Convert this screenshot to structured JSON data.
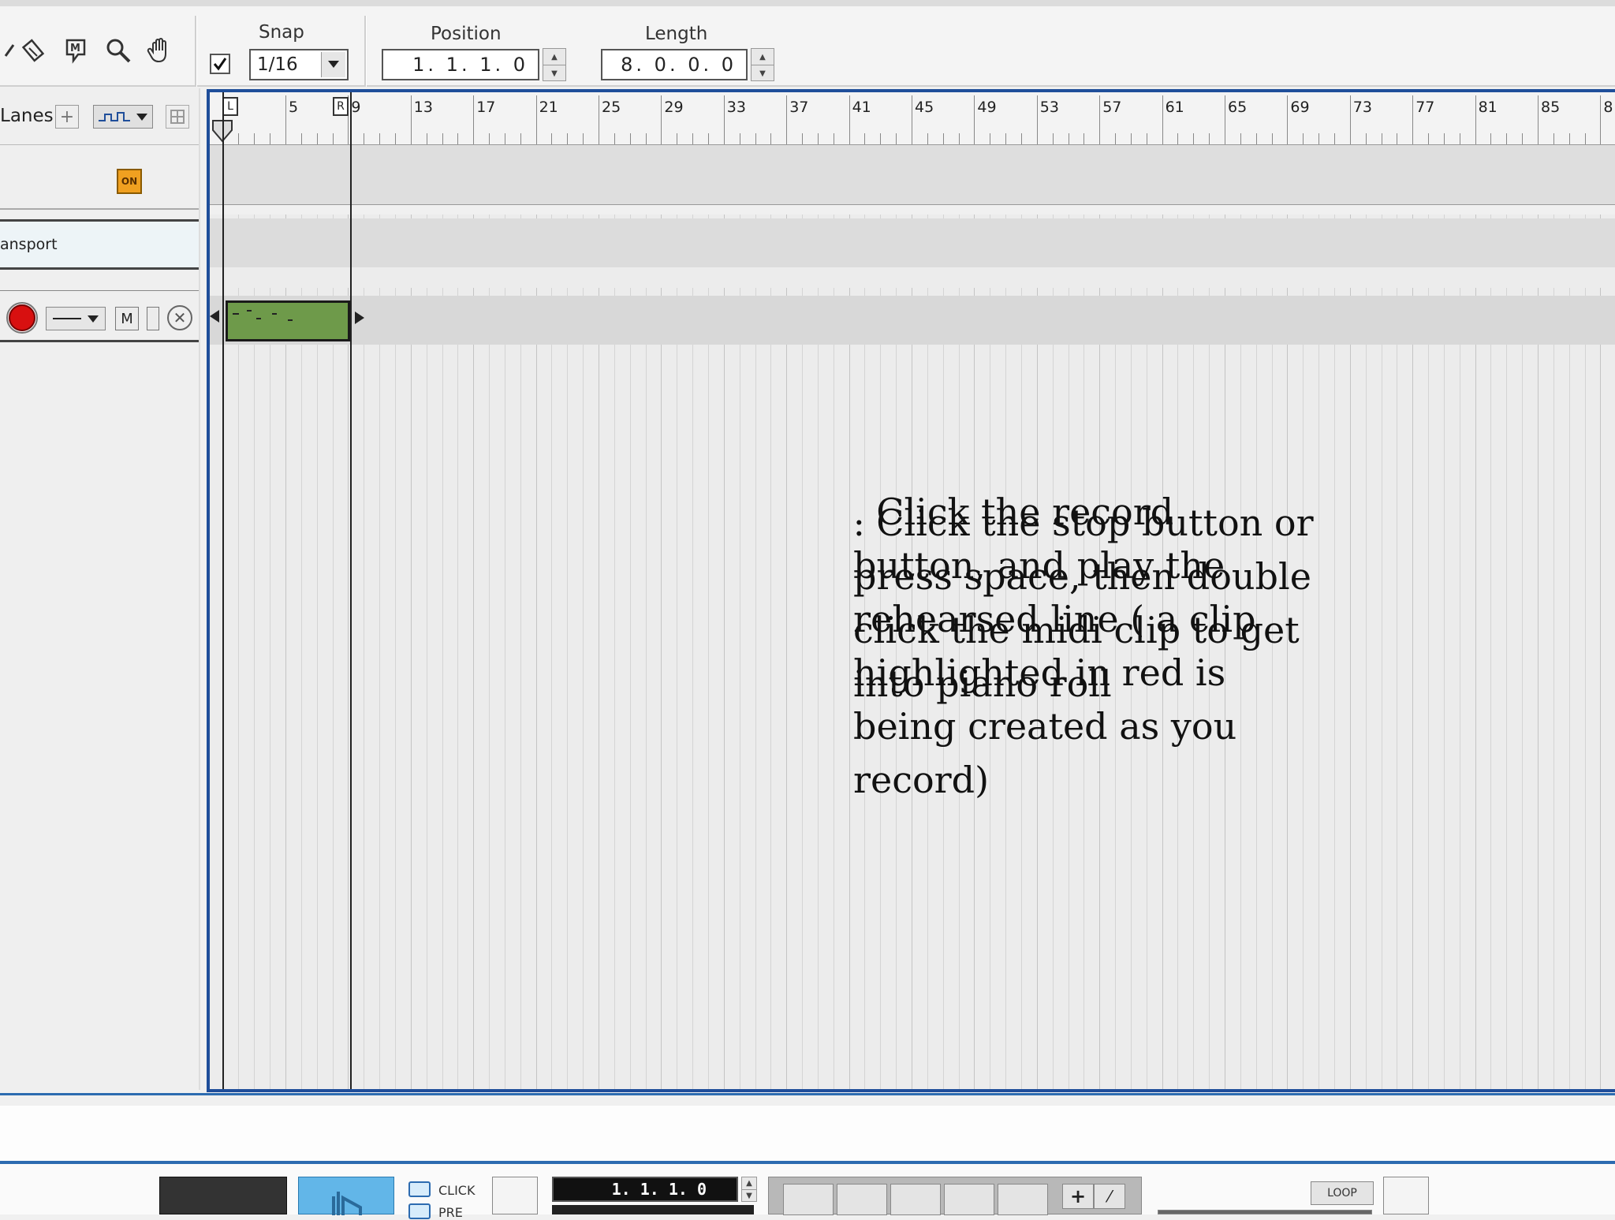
{
  "toolbar": {
    "tools": [
      "pencil-icon",
      "eraser-icon",
      "mute-tool-icon",
      "magnify-icon",
      "hand-icon"
    ],
    "snap_label": "Snap",
    "snap_enabled": true,
    "snap_value": "1/16",
    "position_label": "Position",
    "position_value": "1. 1. 1.   0",
    "length_label": "Length",
    "length_value": "8. 0. 0.   0"
  },
  "track_list": {
    "lanes_label": "Lanes",
    "on_badge": "ON",
    "transport_track": "ansport",
    "mute_label": "M"
  },
  "ruler": {
    "left_locator": "L",
    "right_locator": "R",
    "bars": [
      "5",
      "9",
      "13",
      "17",
      "21",
      "25",
      "29",
      "33",
      "37",
      "41",
      "45",
      "49",
      "53",
      "57",
      "61",
      "65",
      "69",
      "73",
      "77",
      "81",
      "85",
      "8"
    ]
  },
  "instructions": {
    "text_a": ". Click the record button, and play the rehearsed line ( a clip highlighted in red is being created as you record)",
    "text_b": ". Click the stop button or press space, then double click the midi clip to get into piano roll"
  },
  "transport": {
    "click_label": "CLICK",
    "pre_label": "PRE",
    "position_display": "1.  1.  1.   0",
    "loop_label": "LOOP"
  },
  "colors": {
    "arrange_border": "#1f4e9a",
    "clip_fill": "#6e9a4a",
    "record_red": "#d81010",
    "on_badge": "#f0a020"
  }
}
